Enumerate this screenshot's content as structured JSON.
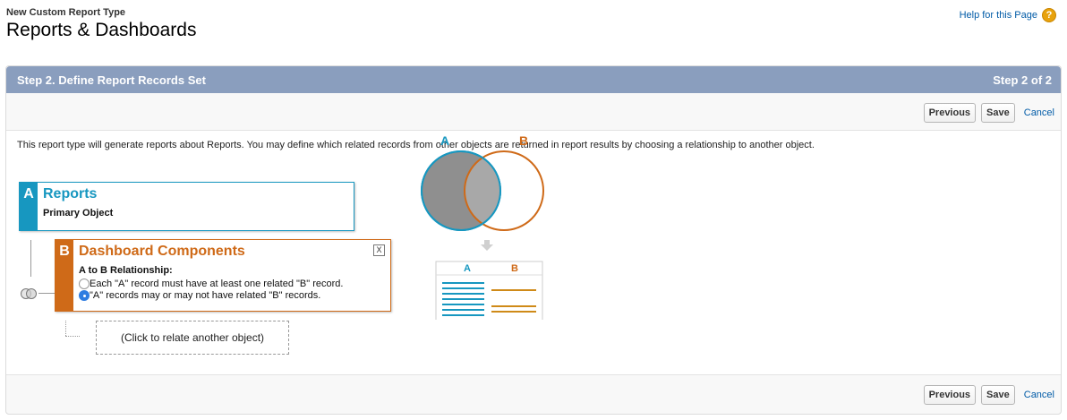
{
  "header": {
    "subtitle": "New Custom Report Type",
    "title": "Reports & Dashboards",
    "help_label": "Help for this Page",
    "help_icon": "question-icon"
  },
  "step": {
    "title": "Step 2. Define Report Records Set",
    "counter": "Step 2 of 2"
  },
  "buttons": {
    "previous": "Previous",
    "save": "Save",
    "cancel": "Cancel"
  },
  "intro": "This report type will generate reports about Reports. You may define which related records from other objects are returned in report results by choosing a relationship to another object.",
  "object_a": {
    "letter": "A",
    "name": "Reports",
    "subtitle": "Primary Object",
    "color": "#1797c0"
  },
  "object_b": {
    "letter": "B",
    "name": "Dashboard Components",
    "relationship_label": "A to B Relationship:",
    "close": "X",
    "color": "#cf6a18",
    "options": [
      {
        "label": "Each \"A\" record must have at least one related \"B\" record.",
        "checked": false
      },
      {
        "label": "\"A\" records may or may not have related \"B\" records.",
        "checked": true
      }
    ]
  },
  "relate_another": "(Click to relate another object)",
  "venn": {
    "label_a": "A",
    "label_b": "B",
    "table_a": "A",
    "table_b": "B"
  },
  "colors": {
    "step_bar": "#8a9ebe",
    "link": "#015ba7",
    "venn_fill": "#8f8f8f"
  }
}
